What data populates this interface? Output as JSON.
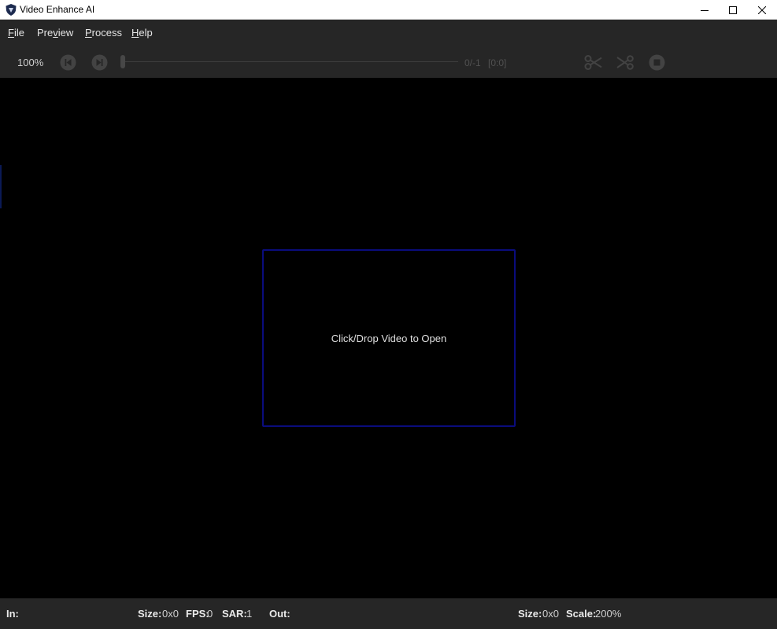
{
  "window": {
    "title": "Video Enhance AI",
    "icon": "topaz-shield-icon",
    "controls": [
      "minimize-icon",
      "maximize-icon",
      "close-icon"
    ]
  },
  "menu": {
    "file": {
      "accel": "F",
      "rest": "ile"
    },
    "preview": {
      "pre": "Pre",
      "accel": "v",
      "rest": "iew"
    },
    "process": {
      "accel": "P",
      "rest": "rocess"
    },
    "help": {
      "accel": "H",
      "rest": "elp"
    }
  },
  "toolbar": {
    "zoom": "100%",
    "frame_counter": "0/-1",
    "frame_range": "[0:0]",
    "icons": [
      "skip-back-icon",
      "skip-forward-icon",
      "scissors-icon",
      "split-icon",
      "stop-icon"
    ]
  },
  "dropzone": {
    "label": "Click/Drop Video to Open"
  },
  "status": {
    "in_label": "In:",
    "in_size_label": "Size:",
    "in_size": "0x0",
    "fps_label": "FPS:",
    "fps": "0",
    "sar_label": "SAR:",
    "sar": "1",
    "out_label": "Out:",
    "out_size_label": "Size:",
    "out_size": "0x0",
    "scale_label": "Scale:",
    "scale": "200%"
  },
  "colors": {
    "background": "#000000",
    "chrome": "#262626",
    "dropzone_border": "#0a0c7d"
  }
}
